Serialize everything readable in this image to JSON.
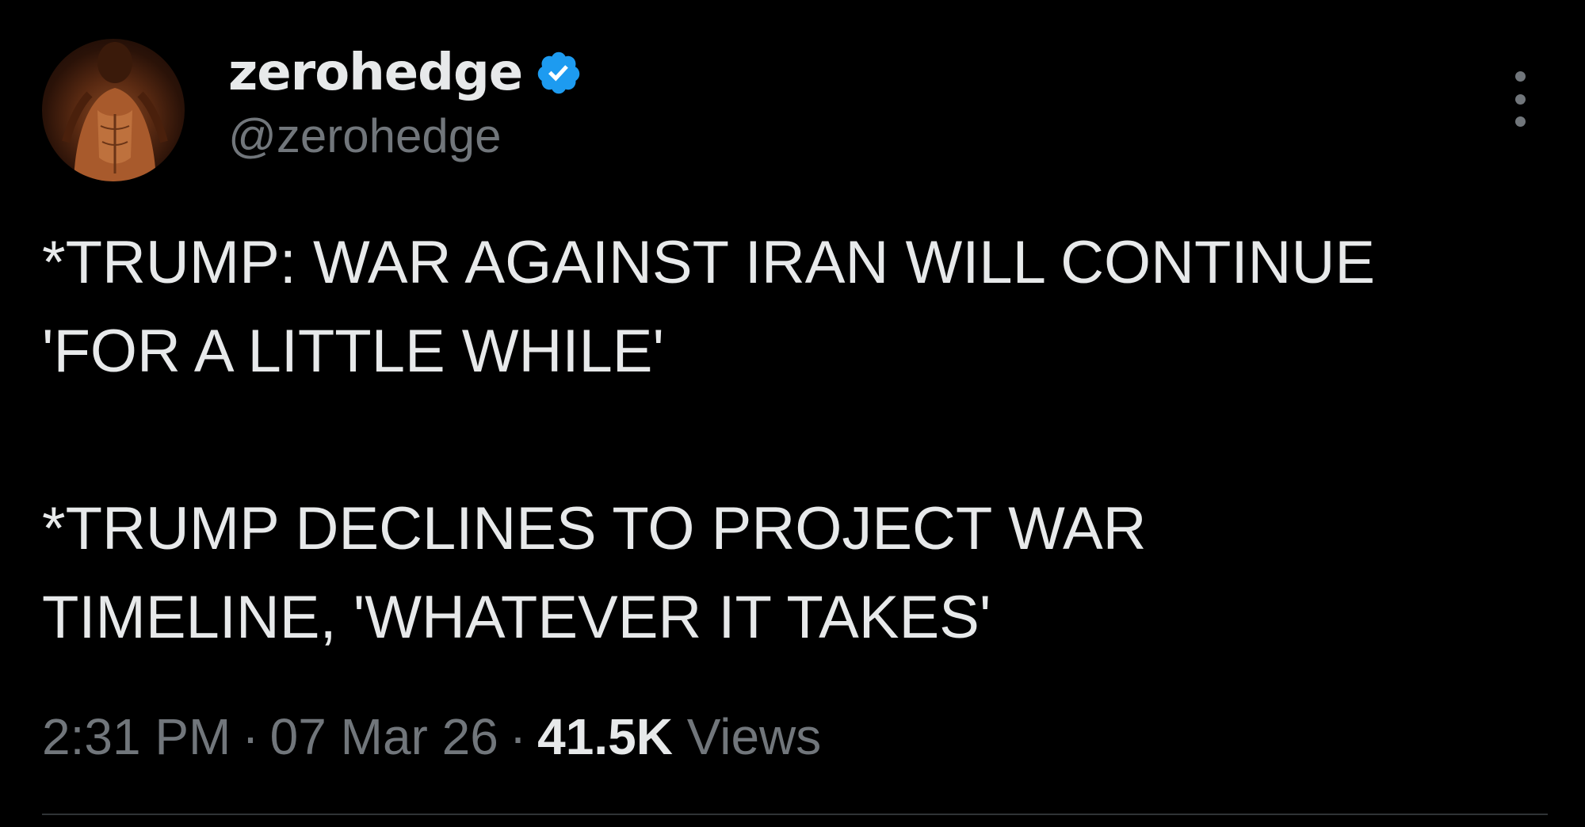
{
  "tweet": {
    "author": {
      "display_name": "zerohedge",
      "handle": "@zerohedge",
      "verified_icon": "verified-badge-icon",
      "verified_color": "#1d9bf0"
    },
    "paragraphs": [
      "*TRUMP: WAR AGAINST IRAN WILL CONTINUE\n'FOR A LITTLE WHILE'",
      "*TRUMP DECLINES TO PROJECT WAR\nTIMELINE, 'WHATEVER IT TAKES'"
    ],
    "meta": {
      "time": "2:31 PM",
      "date": "07 Mar 26",
      "separator": "·",
      "views_count": "41.5K",
      "views_label": "Views"
    },
    "more_icon": "more-options-icon"
  },
  "colors": {
    "background": "#000000",
    "text_primary": "#e7e9ea",
    "text_secondary": "#71767b",
    "divider": "#2f3336"
  }
}
